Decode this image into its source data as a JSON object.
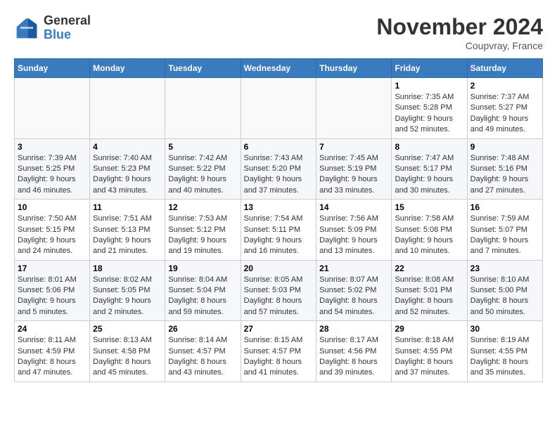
{
  "header": {
    "logo_general": "General",
    "logo_blue": "Blue",
    "month_title": "November 2024",
    "location": "Coupvray, France"
  },
  "days_of_week": [
    "Sunday",
    "Monday",
    "Tuesday",
    "Wednesday",
    "Thursday",
    "Friday",
    "Saturday"
  ],
  "weeks": [
    [
      {
        "day": "",
        "info": ""
      },
      {
        "day": "",
        "info": ""
      },
      {
        "day": "",
        "info": ""
      },
      {
        "day": "",
        "info": ""
      },
      {
        "day": "",
        "info": ""
      },
      {
        "day": "1",
        "info": "Sunrise: 7:35 AM\nSunset: 5:28 PM\nDaylight: 9 hours and 52 minutes."
      },
      {
        "day": "2",
        "info": "Sunrise: 7:37 AM\nSunset: 5:27 PM\nDaylight: 9 hours and 49 minutes."
      }
    ],
    [
      {
        "day": "3",
        "info": "Sunrise: 7:39 AM\nSunset: 5:25 PM\nDaylight: 9 hours and 46 minutes."
      },
      {
        "day": "4",
        "info": "Sunrise: 7:40 AM\nSunset: 5:23 PM\nDaylight: 9 hours and 43 minutes."
      },
      {
        "day": "5",
        "info": "Sunrise: 7:42 AM\nSunset: 5:22 PM\nDaylight: 9 hours and 40 minutes."
      },
      {
        "day": "6",
        "info": "Sunrise: 7:43 AM\nSunset: 5:20 PM\nDaylight: 9 hours and 37 minutes."
      },
      {
        "day": "7",
        "info": "Sunrise: 7:45 AM\nSunset: 5:19 PM\nDaylight: 9 hours and 33 minutes."
      },
      {
        "day": "8",
        "info": "Sunrise: 7:47 AM\nSunset: 5:17 PM\nDaylight: 9 hours and 30 minutes."
      },
      {
        "day": "9",
        "info": "Sunrise: 7:48 AM\nSunset: 5:16 PM\nDaylight: 9 hours and 27 minutes."
      }
    ],
    [
      {
        "day": "10",
        "info": "Sunrise: 7:50 AM\nSunset: 5:15 PM\nDaylight: 9 hours and 24 minutes."
      },
      {
        "day": "11",
        "info": "Sunrise: 7:51 AM\nSunset: 5:13 PM\nDaylight: 9 hours and 21 minutes."
      },
      {
        "day": "12",
        "info": "Sunrise: 7:53 AM\nSunset: 5:12 PM\nDaylight: 9 hours and 19 minutes."
      },
      {
        "day": "13",
        "info": "Sunrise: 7:54 AM\nSunset: 5:11 PM\nDaylight: 9 hours and 16 minutes."
      },
      {
        "day": "14",
        "info": "Sunrise: 7:56 AM\nSunset: 5:09 PM\nDaylight: 9 hours and 13 minutes."
      },
      {
        "day": "15",
        "info": "Sunrise: 7:58 AM\nSunset: 5:08 PM\nDaylight: 9 hours and 10 minutes."
      },
      {
        "day": "16",
        "info": "Sunrise: 7:59 AM\nSunset: 5:07 PM\nDaylight: 9 hours and 7 minutes."
      }
    ],
    [
      {
        "day": "17",
        "info": "Sunrise: 8:01 AM\nSunset: 5:06 PM\nDaylight: 9 hours and 5 minutes."
      },
      {
        "day": "18",
        "info": "Sunrise: 8:02 AM\nSunset: 5:05 PM\nDaylight: 9 hours and 2 minutes."
      },
      {
        "day": "19",
        "info": "Sunrise: 8:04 AM\nSunset: 5:04 PM\nDaylight: 8 hours and 59 minutes."
      },
      {
        "day": "20",
        "info": "Sunrise: 8:05 AM\nSunset: 5:03 PM\nDaylight: 8 hours and 57 minutes."
      },
      {
        "day": "21",
        "info": "Sunrise: 8:07 AM\nSunset: 5:02 PM\nDaylight: 8 hours and 54 minutes."
      },
      {
        "day": "22",
        "info": "Sunrise: 8:08 AM\nSunset: 5:01 PM\nDaylight: 8 hours and 52 minutes."
      },
      {
        "day": "23",
        "info": "Sunrise: 8:10 AM\nSunset: 5:00 PM\nDaylight: 8 hours and 50 minutes."
      }
    ],
    [
      {
        "day": "24",
        "info": "Sunrise: 8:11 AM\nSunset: 4:59 PM\nDaylight: 8 hours and 47 minutes."
      },
      {
        "day": "25",
        "info": "Sunrise: 8:13 AM\nSunset: 4:58 PM\nDaylight: 8 hours and 45 minutes."
      },
      {
        "day": "26",
        "info": "Sunrise: 8:14 AM\nSunset: 4:57 PM\nDaylight: 8 hours and 43 minutes."
      },
      {
        "day": "27",
        "info": "Sunrise: 8:15 AM\nSunset: 4:57 PM\nDaylight: 8 hours and 41 minutes."
      },
      {
        "day": "28",
        "info": "Sunrise: 8:17 AM\nSunset: 4:56 PM\nDaylight: 8 hours and 39 minutes."
      },
      {
        "day": "29",
        "info": "Sunrise: 8:18 AM\nSunset: 4:55 PM\nDaylight: 8 hours and 37 minutes."
      },
      {
        "day": "30",
        "info": "Sunrise: 8:19 AM\nSunset: 4:55 PM\nDaylight: 8 hours and 35 minutes."
      }
    ]
  ]
}
